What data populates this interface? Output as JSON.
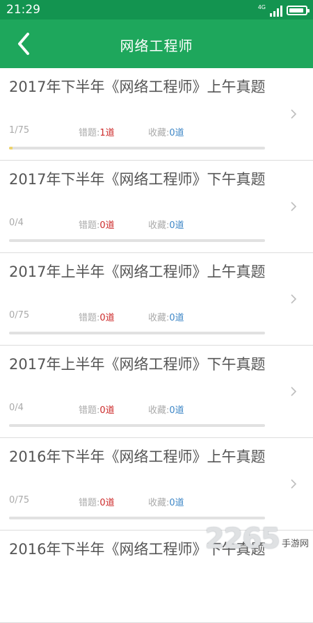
{
  "status_bar": {
    "time": "21:29",
    "network": "4G"
  },
  "header": {
    "title": "网络工程师",
    "back_icon": "chevron-left-icon"
  },
  "colors": {
    "header": "#1ea75c",
    "status_bar": "#139450",
    "wrong": "#cc2a2a",
    "favorite": "#3d86c6",
    "progress_fill": "#ecd36c"
  },
  "items": [
    {
      "title": "2017年下半年《网络工程师》上午真题",
      "progress": "1/75",
      "progress_fraction": 0.0133,
      "wrong_label": "错题:",
      "wrong_value": "1道",
      "fav_label": "收藏:",
      "fav_value": "0道"
    },
    {
      "title": "2017年下半年《网络工程师》下午真题",
      "progress": "0/4",
      "progress_fraction": 0,
      "wrong_label": "错题:",
      "wrong_value": "0道",
      "fav_label": "收藏:",
      "fav_value": "0道"
    },
    {
      "title": "2017年上半年《网络工程师》上午真题",
      "progress": "0/75",
      "progress_fraction": 0,
      "wrong_label": "错题:",
      "wrong_value": "0道",
      "fav_label": "收藏:",
      "fav_value": "0道"
    },
    {
      "title": "2017年上半年《网络工程师》下午真题",
      "progress": "0/4",
      "progress_fraction": 0,
      "wrong_label": "错题:",
      "wrong_value": "0道",
      "fav_label": "收藏:",
      "fav_value": "0道"
    },
    {
      "title": "2016年下半年《网络工程师》上午真题",
      "progress": "0/75",
      "progress_fraction": 0,
      "wrong_label": "错题:",
      "wrong_value": "0道",
      "fav_label": "收藏:",
      "fav_value": "0道"
    },
    {
      "title": "2016年下半年《网络工程师》下午真题",
      "progress": "",
      "progress_fraction": 0,
      "wrong_label": "",
      "wrong_value": "",
      "fav_label": "",
      "fav_value": ""
    }
  ],
  "watermark": {
    "number": "2265",
    "text": "手游网"
  }
}
